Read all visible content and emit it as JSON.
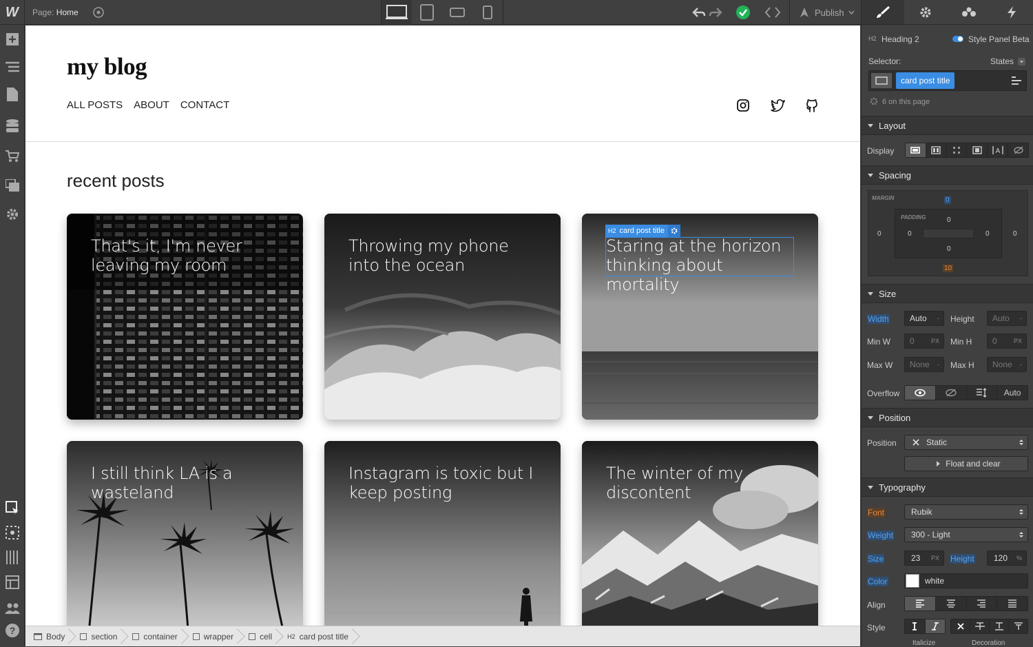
{
  "topbar": {
    "logo": "W",
    "page_label": "Page:",
    "page_name": "Home",
    "publish_label": "Publish"
  },
  "site": {
    "title": "my blog",
    "nav": [
      "ALL POSTS",
      "ABOUT",
      "CONTACT"
    ],
    "section_heading": "recent posts",
    "posts": [
      "That's it, I'm never leaving my room",
      "Throwing my phone into the ocean",
      "Staring at the horizon thinking about mortality",
      "I still think LA is a wasteland",
      "Instagram is toxic but I keep posting",
      "The winter of my discontent"
    ],
    "selected_tag_h": "H2",
    "selected_tag_label": "card post title"
  },
  "breadcrumb": [
    "Body",
    "section",
    "container",
    "wrapper",
    "cell",
    "card post title"
  ],
  "breadcrumb_h2": "H2",
  "panel": {
    "element_type": "Heading 2",
    "element_h": "H2",
    "style_panel_label": "Style Panel Beta",
    "selector_label": "Selector:",
    "states_label": "States",
    "selector_value": "card post title",
    "on_page": "6 on this page",
    "sections": {
      "layout": "Layout",
      "spacing": "Spacing",
      "size": "Size",
      "position": "Position",
      "typography": "Typography"
    },
    "display_label": "Display",
    "spacing": {
      "margin_label": "MARGIN",
      "padding_label": "PADDING",
      "margin_top": "0",
      "margin_left": "0",
      "margin_right": "0",
      "margin_bottom": "10",
      "padding_top": "0",
      "padding_left": "0",
      "padding_right": "0",
      "padding_bottom": "0"
    },
    "size": {
      "width_label": "Width",
      "width": "Auto",
      "height_label": "Height",
      "height": "Auto",
      "minw_label": "Min W",
      "minw": "0",
      "minh_label": "Min H",
      "minh": "0",
      "maxw_label": "Max W",
      "maxw": "None",
      "maxh_label": "Max H",
      "maxh": "None",
      "unit_px": "PX",
      "dash": "-",
      "overflow_label": "Overflow",
      "overflow_auto": "Auto"
    },
    "position": {
      "label": "Position",
      "value": "Static",
      "float_label": "Float and clear"
    },
    "typography": {
      "font_label": "Font",
      "font": "Rubik",
      "weight_label": "Weight",
      "weight": "300 - Light",
      "size_label": "Size",
      "size": "23",
      "size_unit": "PX",
      "lineheight_label": "Height",
      "lineheight": "120",
      "lineheight_unit": "%",
      "color_label": "Color",
      "color": "white",
      "align_label": "Align",
      "style_label": "Style",
      "italicize_label": "Italicize",
      "decoration_label": "Decoration"
    }
  },
  "colors": {
    "accent": "#3a8de3",
    "panel_bg": "#404040",
    "canvas_bg": "#ffffff",
    "orange_label": "#e8893a",
    "publish_check": "#21b35a"
  }
}
